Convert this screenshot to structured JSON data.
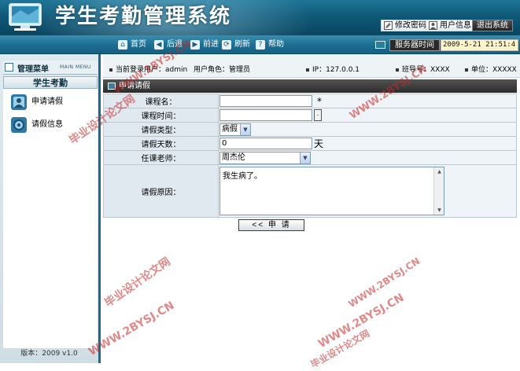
{
  "header": {
    "title": "学生考勤管理系统",
    "buttons": {
      "change_password": "修改密码",
      "user_info": "用户信息",
      "logout": "退出系统"
    }
  },
  "nav": {
    "home": "首页",
    "back": "后退",
    "forward": "前进",
    "refresh": "刷新",
    "help": "帮助",
    "server_time_label": "服务器时间",
    "server_time": "2009-5-21 21:51:4"
  },
  "sidebar": {
    "title": "管理菜单",
    "subtitle": "MAIN MENU",
    "section": "学生考勤",
    "items": [
      {
        "label": "申请请假",
        "icon": "leave-request-icon"
      },
      {
        "label": "请假信息",
        "icon": "leave-info-icon"
      }
    ],
    "version": "版本：2009 v1.0"
  },
  "infobar": {
    "current_user": "当前登录用户：admin",
    "role": "用户角色：管理员",
    "ip": "IP：127.0.0.1",
    "department": "班导号：XXXX",
    "unit": "单位：XXXXX"
  },
  "form": {
    "title": "申请请假",
    "fields": {
      "course_name": {
        "label": "课程名：",
        "value": "",
        "required_mark": "*"
      },
      "course_time": {
        "label": "课程时间：",
        "value": ""
      },
      "leave_type": {
        "label": "请假类型：",
        "value": "病假"
      },
      "leave_days": {
        "label": "请假天数：",
        "value": "0",
        "unit": "天"
      },
      "teacher": {
        "label": "任课老师：",
        "value": "周杰伦"
      },
      "reason": {
        "label": "请假原因：",
        "value": "我生病了。"
      }
    },
    "submit_label": "<< 申 请"
  },
  "watermarks": [
    "毕业设计论文网",
    "WWW.2BYSJ.CN"
  ],
  "colors": {
    "header_blue": "#0f5877",
    "nav_blue": "#1e6f93",
    "panel_title": "#2c2c2c",
    "label_bg": "#dfe9ef",
    "watermark_red": "#c82828"
  }
}
